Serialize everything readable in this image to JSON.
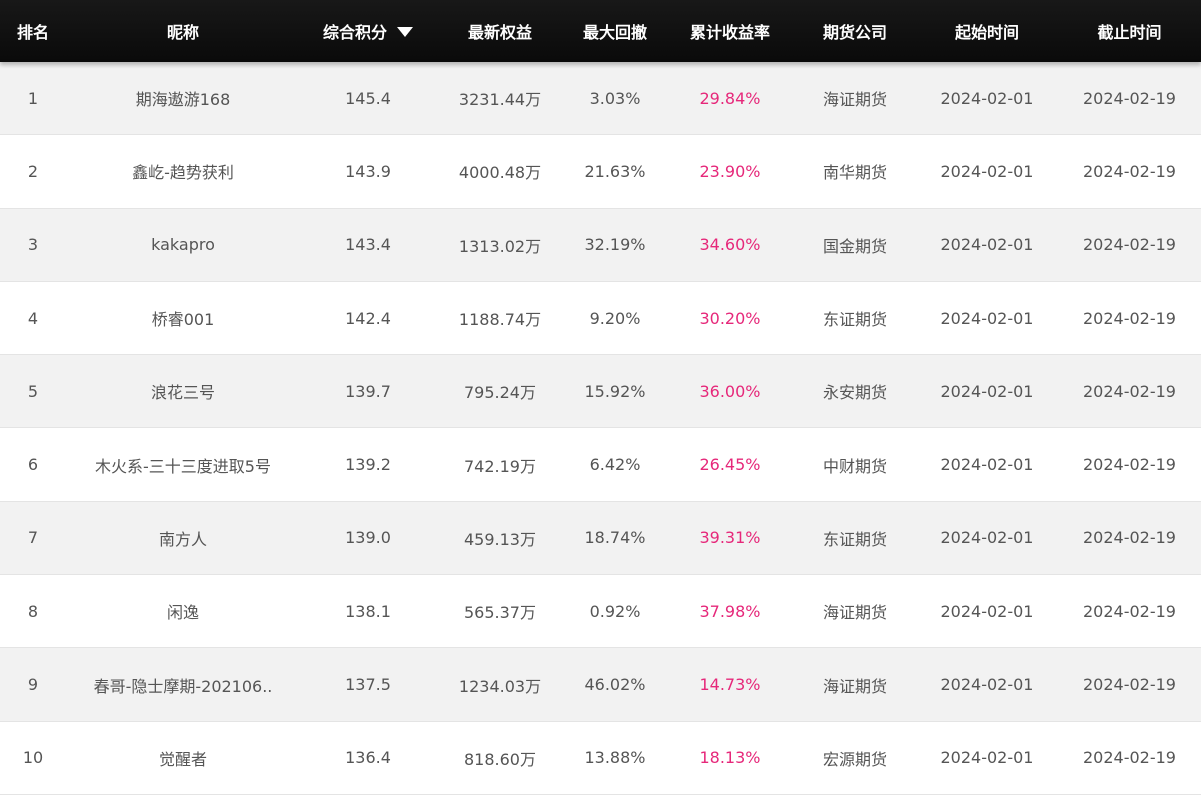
{
  "headers": {
    "rank": "排名",
    "nickname": "昵称",
    "score": "综合积分",
    "equity": "最新权益",
    "max_drawdown": "最大回撤",
    "cumulative_return": "累计收益率",
    "broker": "期货公司",
    "start_date": "起始时间",
    "end_date": "截止时间"
  },
  "sort_icon": "caret-down-icon",
  "accent_color": "#e6287a",
  "rows": [
    {
      "rank": "1",
      "nickname": "期海遨游168",
      "score": "145.4",
      "equity": "3231.44万",
      "max_drawdown": "3.03%",
      "cumulative_return": "29.84%",
      "broker": "海证期货",
      "start_date": "2024-02-01",
      "end_date": "2024-02-19"
    },
    {
      "rank": "2",
      "nickname": "鑫屹-趋势获利",
      "score": "143.9",
      "equity": "4000.48万",
      "max_drawdown": "21.63%",
      "cumulative_return": "23.90%",
      "broker": "南华期货",
      "start_date": "2024-02-01",
      "end_date": "2024-02-19"
    },
    {
      "rank": "3",
      "nickname": "kakapro",
      "score": "143.4",
      "equity": "1313.02万",
      "max_drawdown": "32.19%",
      "cumulative_return": "34.60%",
      "broker": "国金期货",
      "start_date": "2024-02-01",
      "end_date": "2024-02-19"
    },
    {
      "rank": "4",
      "nickname": "桥睿001",
      "score": "142.4",
      "equity": "1188.74万",
      "max_drawdown": "9.20%",
      "cumulative_return": "30.20%",
      "broker": "东证期货",
      "start_date": "2024-02-01",
      "end_date": "2024-02-19"
    },
    {
      "rank": "5",
      "nickname": "浪花三号",
      "score": "139.7",
      "equity": "795.24万",
      "max_drawdown": "15.92%",
      "cumulative_return": "36.00%",
      "broker": "永安期货",
      "start_date": "2024-02-01",
      "end_date": "2024-02-19"
    },
    {
      "rank": "6",
      "nickname": "木火系-三十三度进取5号",
      "score": "139.2",
      "equity": "742.19万",
      "max_drawdown": "6.42%",
      "cumulative_return": "26.45%",
      "broker": "中财期货",
      "start_date": "2024-02-01",
      "end_date": "2024-02-19"
    },
    {
      "rank": "7",
      "nickname": "南方人",
      "score": "139.0",
      "equity": "459.13万",
      "max_drawdown": "18.74%",
      "cumulative_return": "39.31%",
      "broker": "东证期货",
      "start_date": "2024-02-01",
      "end_date": "2024-02-19"
    },
    {
      "rank": "8",
      "nickname": "闲逸",
      "score": "138.1",
      "equity": "565.37万",
      "max_drawdown": "0.92%",
      "cumulative_return": "37.98%",
      "broker": "海证期货",
      "start_date": "2024-02-01",
      "end_date": "2024-02-19"
    },
    {
      "rank": "9",
      "nickname": "春哥-隐士摩期-202106..",
      "score": "137.5",
      "equity": "1234.03万",
      "max_drawdown": "46.02%",
      "cumulative_return": "14.73%",
      "broker": "海证期货",
      "start_date": "2024-02-01",
      "end_date": "2024-02-19"
    },
    {
      "rank": "10",
      "nickname": "觉醒者",
      "score": "136.4",
      "equity": "818.60万",
      "max_drawdown": "13.88%",
      "cumulative_return": "18.13%",
      "broker": "宏源期货",
      "start_date": "2024-02-01",
      "end_date": "2024-02-19"
    }
  ]
}
